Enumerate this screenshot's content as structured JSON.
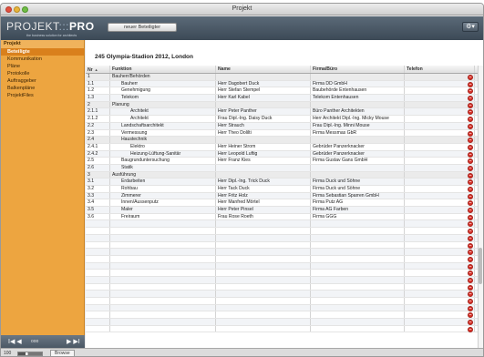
{
  "window": {
    "title": "Projekt"
  },
  "header": {
    "logo_main": "PROJEKT",
    "logo_sep": ":::",
    "logo_pro": "PRO",
    "tagline": "the business solution for architects",
    "new_button": "neuer Beteiligter",
    "gear_icon": "gear-icon"
  },
  "sidebar": {
    "section": "Projekt",
    "items": [
      {
        "label": "Beteiligte",
        "active": true
      },
      {
        "label": "Kommunikation",
        "active": false
      },
      {
        "label": "Pläne",
        "active": false
      },
      {
        "label": "Protokolle",
        "active": false
      },
      {
        "label": "Auftraggeber",
        "active": false
      },
      {
        "label": "Balkenpläne",
        "active": false
      },
      {
        "label": "ProjektFiles",
        "active": false
      }
    ]
  },
  "navigation": {
    "first": "I◀ ◀",
    "position": "ooo",
    "last": "▶ ▶I"
  },
  "footer": {
    "zoom": "100",
    "mode": "Browse"
  },
  "project": {
    "title": "245  Olympia-Stadion 2012, London"
  },
  "table": {
    "headers": {
      "nr": "Nr",
      "funktion": "Funktion",
      "name": "Name",
      "firma": "Firma/Büro",
      "telefon": "Telefon"
    },
    "rows": [
      {
        "nr": "1",
        "funktion": "Bauherr/Behörden",
        "name": "",
        "firma": "",
        "indent": 0,
        "group": true
      },
      {
        "nr": "1.1",
        "funktion": "Bauherr",
        "name": "Herr Dagobert Duck",
        "firma": "Firma DD GmbH",
        "indent": 1
      },
      {
        "nr": "1.2",
        "funktion": "Genehmigung",
        "name": "Herr Stefan Stempel",
        "firma": "Baubehörde Entenhausen",
        "indent": 1
      },
      {
        "nr": "1.3",
        "funktion": "Telekom",
        "name": "Herr Karl Kabel",
        "firma": "Telekom Entenhausen",
        "indent": 1
      },
      {
        "nr": "2",
        "funktion": "Planung",
        "name": "",
        "firma": "",
        "indent": 0,
        "group": true
      },
      {
        "nr": "2.1.1",
        "funktion": "Architekt",
        "name": "Herr Peter Panther",
        "firma": "Büro Panther Architekten",
        "indent": 2
      },
      {
        "nr": "2.1.2",
        "funktion": "Architekt",
        "name": "Frau Dipl.-Ing. Daisy Duck",
        "firma": "Herr Architekt Dipl.-Ing. Micky  Mouse",
        "indent": 2
      },
      {
        "nr": "2.2",
        "funktion": "Landschaftsarchitekt",
        "name": "Herr Strauch",
        "firma": "Frau Dipl.-Ing. Minni Mouse",
        "indent": 1
      },
      {
        "nr": "2.3",
        "funktion": "Vermessung",
        "name": "Herr Theo Dolilti",
        "firma": "Firma Messmas GbR",
        "indent": 1
      },
      {
        "nr": "2.4",
        "funktion": "Haustechnik",
        "name": "",
        "firma": "",
        "indent": 1,
        "group": true
      },
      {
        "nr": "2.4.1",
        "funktion": "Elektro",
        "name": "Herr Heiner Strom",
        "firma": "Gebrüder Panzerknacker",
        "indent": 2
      },
      {
        "nr": "2.4.2",
        "funktion": "Heizung-Lüftung-Sanitär",
        "name": "Herr Leopold Luftig",
        "firma": "Gebrüder Panzerknacker",
        "indent": 2
      },
      {
        "nr": "2.5",
        "funktion": "Baugrunduntersuchung",
        "name": "Herr Franz Kies",
        "firma": "Firma Gustav Gans GmbH",
        "indent": 1
      },
      {
        "nr": "2.6",
        "funktion": "Statik",
        "name": "",
        "firma": "",
        "indent": 1
      },
      {
        "nr": "3",
        "funktion": "Ausführung",
        "name": "",
        "firma": "",
        "indent": 0,
        "group": true
      },
      {
        "nr": "3.1",
        "funktion": "Erdarbeiten",
        "name": "Herr Dipl.-Ing. Trick Duck",
        "firma": "Firma Duck und Söhne",
        "indent": 1
      },
      {
        "nr": "3.2",
        "funktion": "Rohbau",
        "name": "Herr Tack Duck",
        "firma": "Firma Duck und Söhne",
        "indent": 1
      },
      {
        "nr": "3.3",
        "funktion": "Zimmerer",
        "name": "Herr Fritz Holz",
        "firma": "Firma Sebastian Sparren GmbH",
        "indent": 1
      },
      {
        "nr": "3.4",
        "funktion": "Innen/Aussenputz",
        "name": "Herr Manfred Mörtel",
        "firma": "Firma Putz AG",
        "indent": 1
      },
      {
        "nr": "3.5",
        "funktion": "Maler",
        "name": "Herr Peter Pinsel",
        "firma": "Firma AG Farben",
        "indent": 1
      },
      {
        "nr": "3.6",
        "funktion": "Freiraum",
        "name": "Frau Rose Roeth",
        "firma": "Firma GGG",
        "indent": 1
      },
      {
        "nr": "",
        "funktion": "",
        "name": "",
        "firma": "",
        "indent": 0
      },
      {
        "nr": "",
        "funktion": "",
        "name": "",
        "firma": "",
        "indent": 0
      },
      {
        "nr": "",
        "funktion": "",
        "name": "",
        "firma": "",
        "indent": 0
      },
      {
        "nr": "",
        "funktion": "",
        "name": "",
        "firma": "",
        "indent": 0
      },
      {
        "nr": "",
        "funktion": "",
        "name": "",
        "firma": "",
        "indent": 0
      },
      {
        "nr": "",
        "funktion": "",
        "name": "",
        "firma": "",
        "indent": 0
      },
      {
        "nr": "",
        "funktion": "",
        "name": "",
        "firma": "",
        "indent": 0
      },
      {
        "nr": "",
        "funktion": "",
        "name": "",
        "firma": "",
        "indent": 0
      },
      {
        "nr": "",
        "funktion": "",
        "name": "",
        "firma": "",
        "indent": 0
      },
      {
        "nr": "",
        "funktion": "",
        "name": "",
        "firma": "",
        "indent": 0
      },
      {
        "nr": "",
        "funktion": "",
        "name": "",
        "firma": "",
        "indent": 0
      },
      {
        "nr": "",
        "funktion": "",
        "name": "",
        "firma": "",
        "indent": 0
      },
      {
        "nr": "",
        "funktion": "",
        "name": "",
        "firma": "",
        "indent": 0
      },
      {
        "nr": "",
        "funktion": "",
        "name": "",
        "firma": "",
        "indent": 0
      },
      {
        "nr": "",
        "funktion": "",
        "name": "",
        "firma": "",
        "indent": 0
      },
      {
        "nr": "",
        "funktion": "",
        "name": "",
        "firma": "",
        "indent": 0
      }
    ]
  },
  "colors": {
    "sidebar": "#eda540",
    "sidebar_active": "#d9801c",
    "header": "#4a5764",
    "delete": "#d9332a"
  }
}
